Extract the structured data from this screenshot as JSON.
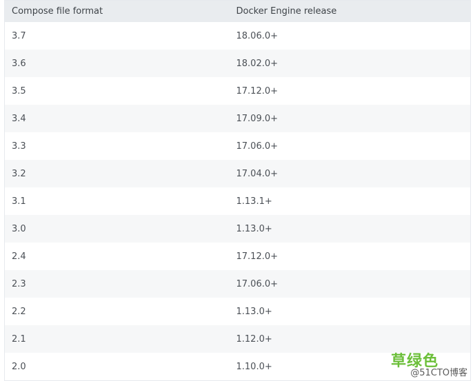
{
  "table": {
    "headers": [
      "Compose file format",
      "Docker Engine release"
    ],
    "rows": [
      [
        "3.7",
        "18.06.0+"
      ],
      [
        "3.6",
        "18.02.0+"
      ],
      [
        "3.5",
        "17.12.0+"
      ],
      [
        "3.4",
        "17.09.0+"
      ],
      [
        "3.3",
        "17.06.0+"
      ],
      [
        "3.2",
        "17.04.0+"
      ],
      [
        "3.1",
        "1.13.1+"
      ],
      [
        "3.0",
        "1.13.0+"
      ],
      [
        "2.4",
        "17.12.0+"
      ],
      [
        "2.3",
        "17.06.0+"
      ],
      [
        "2.2",
        "1.13.0+"
      ],
      [
        "2.1",
        "1.12.0+"
      ],
      [
        "2.0",
        "1.10.0+"
      ]
    ]
  },
  "watermark": {
    "main": "草绿色",
    "sub": "@51CTO博客"
  },
  "colors": {
    "header_bg": "#e9ecef",
    "row_alt_bg": "#f6f7f8",
    "text": "#4a4f55",
    "watermark_green": "#6cbf3a"
  }
}
